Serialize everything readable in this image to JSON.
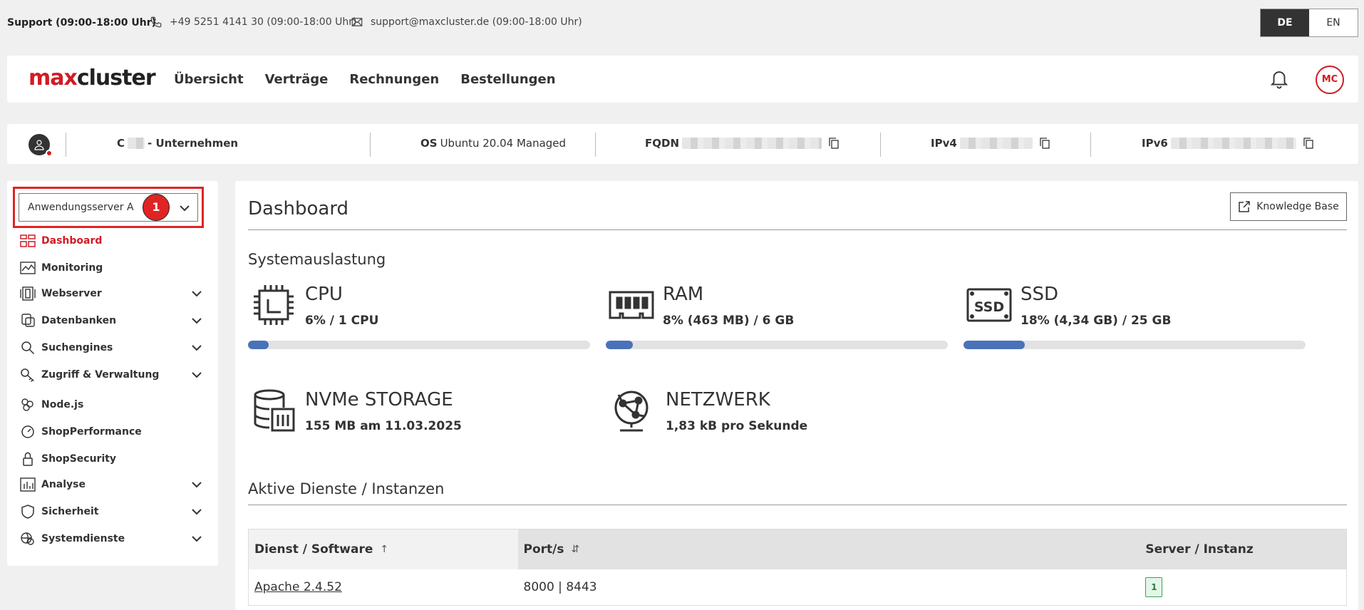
{
  "topbar": {
    "support_title": "Support (09:00-18:00 Uhr)",
    "phone": "+49 5251 4141 30 (09:00-18:00 Uhr)",
    "email": "support@maxcluster.de (09:00-18:00 Uhr)",
    "languages": [
      "DE",
      "EN"
    ],
    "active_language": "DE"
  },
  "navbar": {
    "logo_part1": "max",
    "logo_part2": "cluster",
    "links": [
      "Übersicht",
      "Verträge",
      "Rechnungen",
      "Bestellungen"
    ],
    "avatar_initials": "MC"
  },
  "infobar": {
    "company_prefix": "C",
    "company_suffix": "- Unternehmen",
    "os_label": "OS",
    "os_value": "Ubuntu 20.04 Managed",
    "fqdn_label": "FQDN",
    "ipv4_label": "IPv4",
    "ipv6_label": "IPv6"
  },
  "sidebar": {
    "server_select_value": "Anwendungsserver A",
    "server_badge": "1",
    "items": [
      {
        "label": "Dashboard",
        "icon": "dashboard-grid-icon",
        "active": true,
        "expandable": false
      },
      {
        "label": "Monitoring",
        "icon": "monitoring-chart-icon",
        "active": false,
        "expandable": false
      },
      {
        "label": "Webserver",
        "icon": "webserver-icon",
        "active": false,
        "expandable": true
      },
      {
        "label": "Datenbanken",
        "icon": "database-icon",
        "active": false,
        "expandable": true
      },
      {
        "label": "Suchengines",
        "icon": "search-icon",
        "active": false,
        "expandable": true
      },
      {
        "label": "Zugriff & Verwaltung",
        "icon": "key-icon",
        "active": false,
        "expandable": true
      },
      {
        "label": "Node.js",
        "icon": "nodejs-icon",
        "active": false,
        "expandable": false
      },
      {
        "label": "ShopPerformance",
        "icon": "speedometer-icon",
        "active": false,
        "expandable": false
      },
      {
        "label": "ShopSecurity",
        "icon": "lock-icon",
        "active": false,
        "expandable": false
      },
      {
        "label": "Analyse",
        "icon": "analysis-chart-icon",
        "active": false,
        "expandable": true
      },
      {
        "label": "Sicherheit",
        "icon": "shield-icon",
        "active": false,
        "expandable": true
      },
      {
        "label": "Systemdienste",
        "icon": "system-services-icon",
        "active": false,
        "expandable": true
      }
    ]
  },
  "main": {
    "title": "Dashboard",
    "kb_button": "Knowledge Base",
    "system_section": "Systemauslastung",
    "metrics": {
      "cpu": {
        "name": "CPU",
        "value": "6% / 1 CPU",
        "percent": 6
      },
      "ram": {
        "name": "RAM",
        "value": "8% (463 MB) / 6 GB",
        "percent": 8
      },
      "ssd": {
        "name": "SSD",
        "value": "18% (4,34 GB) / 25 GB",
        "percent": 18
      },
      "nvme": {
        "name": "NVMe STORAGE",
        "value": "155 MB am 11.03.2025"
      },
      "network": {
        "name": "NETZWERK",
        "value": "1,83 kB pro Sekunde"
      }
    },
    "services_section": "Aktive Dienste / Instanzen",
    "table": {
      "headers": [
        "Dienst / Software",
        "Port/s",
        "Server / Instanz"
      ],
      "rows": [
        {
          "service": "Apache 2.4.52",
          "ports": "8000 | 8443",
          "instance": "1"
        }
      ]
    }
  },
  "colors": {
    "brand_red": "#d11b24",
    "progress_blue": "#4a72b8",
    "highlight_red": "#e02424"
  }
}
